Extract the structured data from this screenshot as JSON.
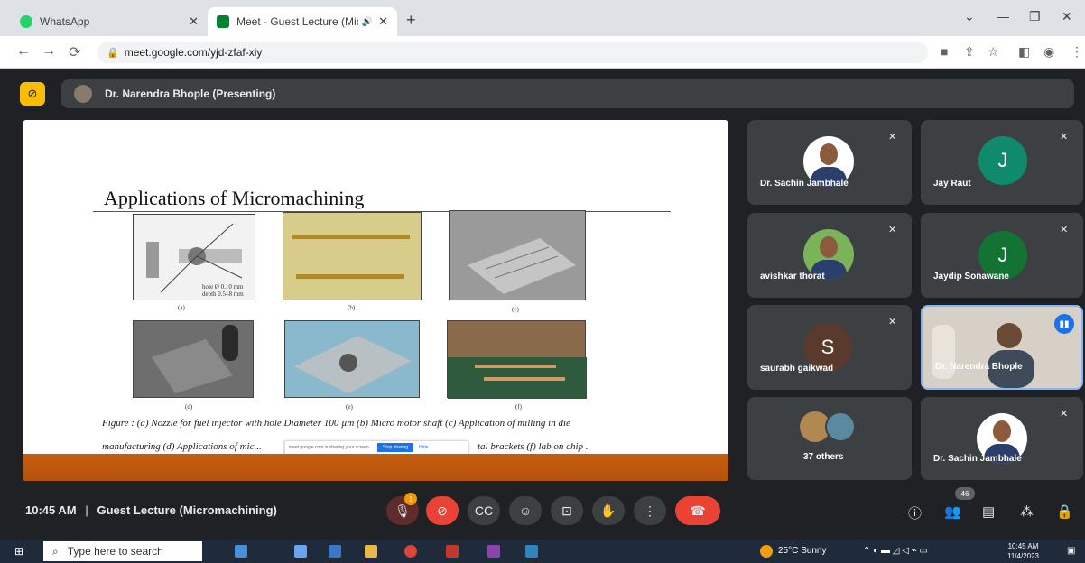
{
  "browser": {
    "tabs": [
      {
        "label": "WhatsApp",
        "fav_color": "#25d366"
      },
      {
        "label": "Meet - Guest Lecture (Micro",
        "fav_color": "#00832d"
      }
    ],
    "url": "meet.google.com/yjd-zfaf-xiy"
  },
  "meet": {
    "presenter_label": "Dr. Narendra Bhople (Presenting)",
    "slide": {
      "title": "Applications of Micromachining",
      "image_labels": [
        "(a)",
        "(b)",
        "(c)",
        "(d)",
        "(e)",
        "(f)"
      ],
      "hole_note_1": "hole Ø 0.10 mm",
      "hole_note_2": "depth 0.5–8 mm",
      "caption_line1": "Figure : (a) Nozzle for fuel injector with hole Diameter 100 µm  (b) Micro motor shaft (c) Application of milling in die",
      "caption_line2a": "manufacturing (d) Applications of mic...",
      "caption_line2b": "tal brackets (f) lab on chip .",
      "sharing_note": "meet.google.com is sharing your screen.",
      "stop_sharing": "Stop sharing",
      "hide": "Hide"
    },
    "participants": [
      {
        "name": "Dr. Sachin Jambhale",
        "kind": "photo"
      },
      {
        "name": "Jay Raut",
        "kind": "letter",
        "letter": "J",
        "color": "#0f8a6c"
      },
      {
        "name": "avishkar thorat",
        "kind": "photo"
      },
      {
        "name": "Jaydip Sonawane",
        "kind": "letter",
        "letter": "J",
        "color": "#137333"
      },
      {
        "name": "saurabh gaikwad",
        "kind": "letter",
        "letter": "S",
        "color": "#5b3a2e"
      },
      {
        "name": "Dr. Narendra Bhople",
        "kind": "video"
      },
      {
        "name": "37 others",
        "kind": "others"
      },
      {
        "name": "Dr. Sachin Jambhale",
        "kind": "photo"
      }
    ],
    "time": "10:45 AM",
    "meeting_title": "Guest Lecture (Micromachining)",
    "mic_badge": "1",
    "people_count": "46"
  },
  "taskbar": {
    "search_placeholder": "Type here to search",
    "weather": "25°C  Sunny",
    "clock_time": "10:45 AM",
    "clock_date": "11/4/2023"
  }
}
